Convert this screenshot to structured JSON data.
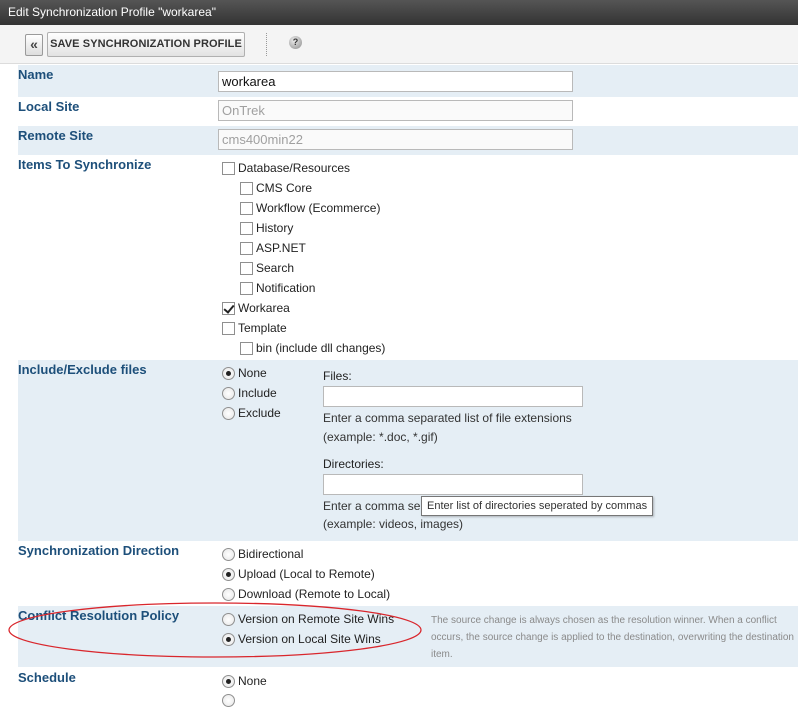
{
  "window": {
    "title": "Edit Synchronization Profile \"workarea\""
  },
  "toolbar": {
    "back_glyph": "«",
    "save_label": "SAVE SYNCHRONIZATION PROFILE",
    "help_glyph": "?"
  },
  "colors": {
    "label": "#1d4f7a",
    "alt_row": "#e5eef5",
    "annotation": "#d9262c"
  },
  "name": {
    "label": "Name",
    "value": "workarea"
  },
  "local_site": {
    "label": "Local Site",
    "value": "OnTrek"
  },
  "remote_site": {
    "label": "Remote Site",
    "value": "cms400min22"
  },
  "items": {
    "label": "Items To Synchronize",
    "database": "Database/Resources",
    "cms_core": "CMS Core",
    "workflow": "Workflow (Ecommerce)",
    "history": "History",
    "aspnet": "ASP.NET",
    "search": "Search",
    "notification": "Notification",
    "workarea": "Workarea",
    "template": "Template",
    "bin": "bin (include dll changes)"
  },
  "include_exclude": {
    "label": "Include/Exclude files",
    "none": "None",
    "include": "Include",
    "exclude": "Exclude",
    "files_label": "Files:",
    "files_help_1": "Enter a comma separated list of file extensions",
    "files_help_2": "(example: *.doc, *.gif)",
    "directories_label": "Directories:",
    "dir_help_1": "Enter a comma se",
    "dir_help_2": "(example: videos, images)",
    "tooltip": "Enter list of directories seperated by commas"
  },
  "direction": {
    "label": "Synchronization Direction",
    "bidirectional": "Bidirectional",
    "upload": "Upload (Local to Remote)",
    "download": "Download (Remote to Local)"
  },
  "conflict": {
    "label": "Conflict Resolution Policy",
    "remote_wins": "Version on Remote Site Wins",
    "local_wins": "Version on Local Site Wins",
    "description": "The source change is always chosen as the resolution winner. When a conflict occurs, the source change is applied to the destination, overwriting the destination item."
  },
  "schedule": {
    "label": "Schedule",
    "none": "None"
  }
}
